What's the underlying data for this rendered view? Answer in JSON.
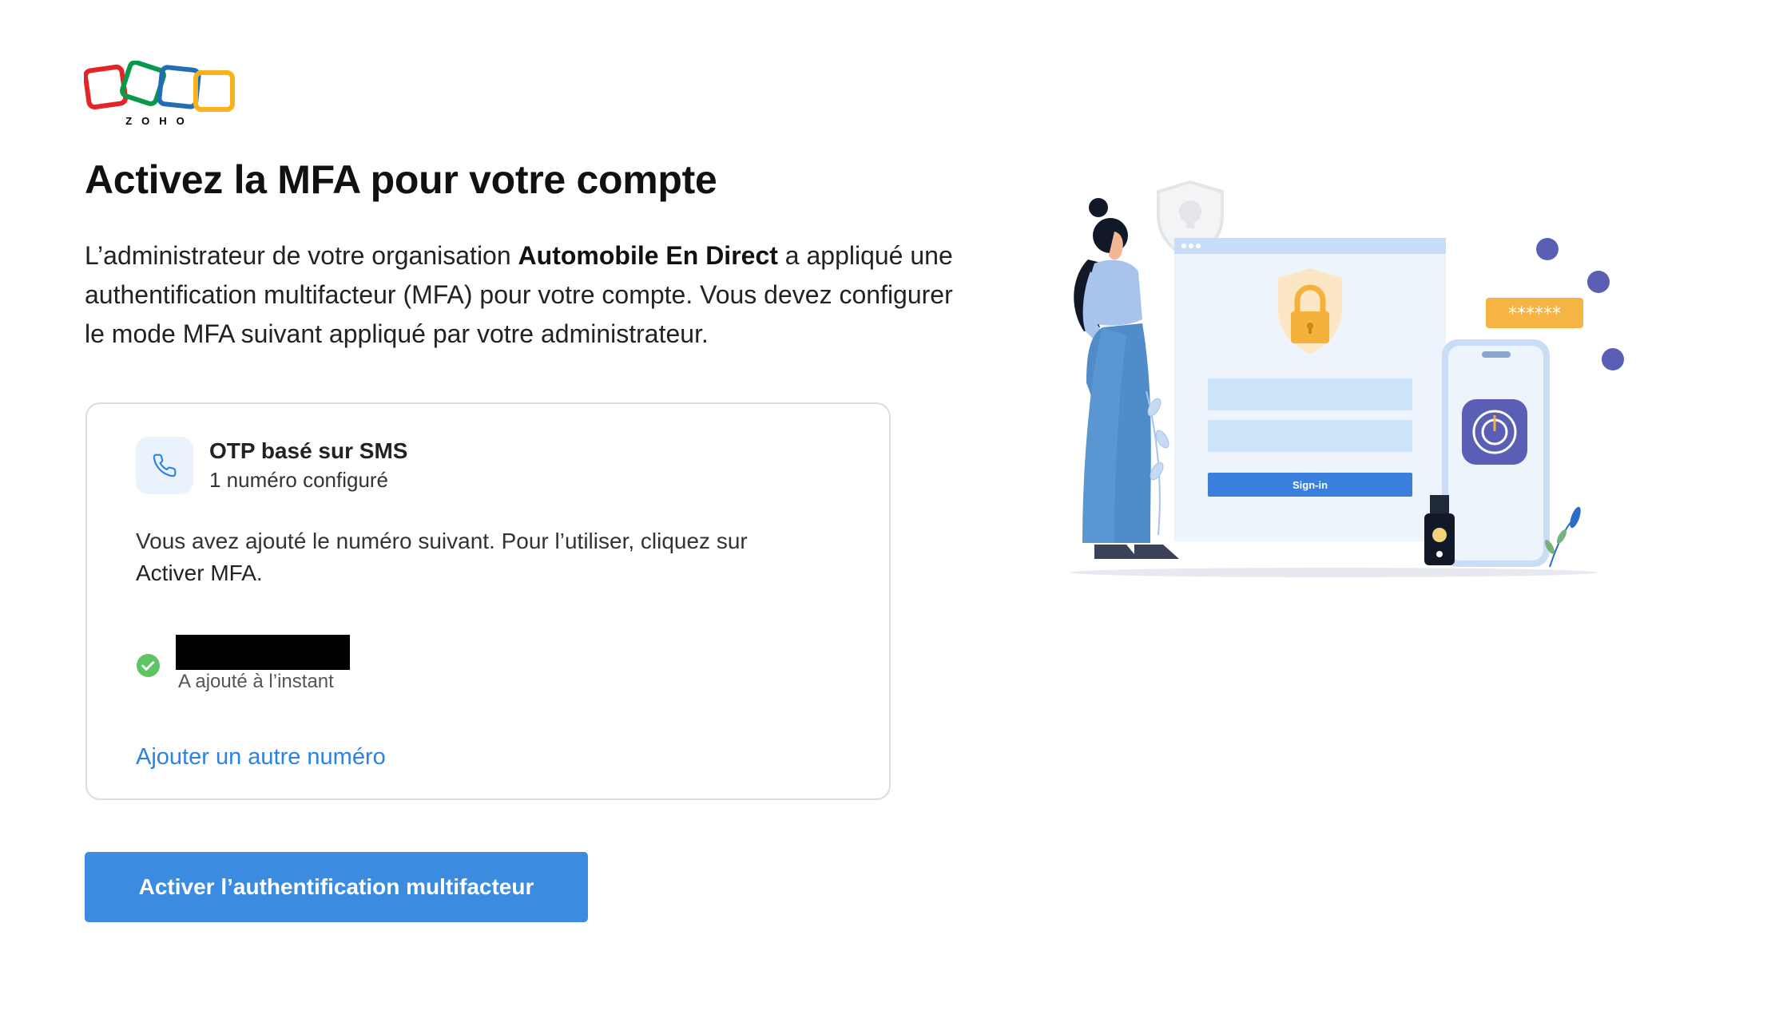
{
  "logo": {
    "wordmark": "ZOHO",
    "colors": [
      "#e42527",
      "#089949",
      "#226db4",
      "#f9b21d"
    ]
  },
  "heading": {
    "title": "Activez la MFA pour votre compte"
  },
  "intro": {
    "part1": "L’administrateur de votre organisation ",
    "org_name": "Automobile En Direct",
    "part2": " a appliqué une authentification multifacteur (MFA) pour votre compte. Vous devez configurer le mode MFA suivant appliqué par votre administrateur."
  },
  "method_card": {
    "icon": "phone-icon",
    "method_name": "OTP basé sur SMS",
    "method_sub": "1 numéro configuré",
    "desc_part1": "Vous avez ajouté le numéro suivant. Pour l’utiliser, cliquez sur ",
    "desc_strong": "Activer MFA",
    "desc_end": ".",
    "number_status": "A ajouté à l’instant",
    "add_link": "Ajouter un autre numéro"
  },
  "primary_button": {
    "label": "Activer l’authentification multifacteur",
    "color": "#3b8be0"
  },
  "illustration": {
    "signin_label": "Sign-in",
    "password_mask": "******"
  }
}
